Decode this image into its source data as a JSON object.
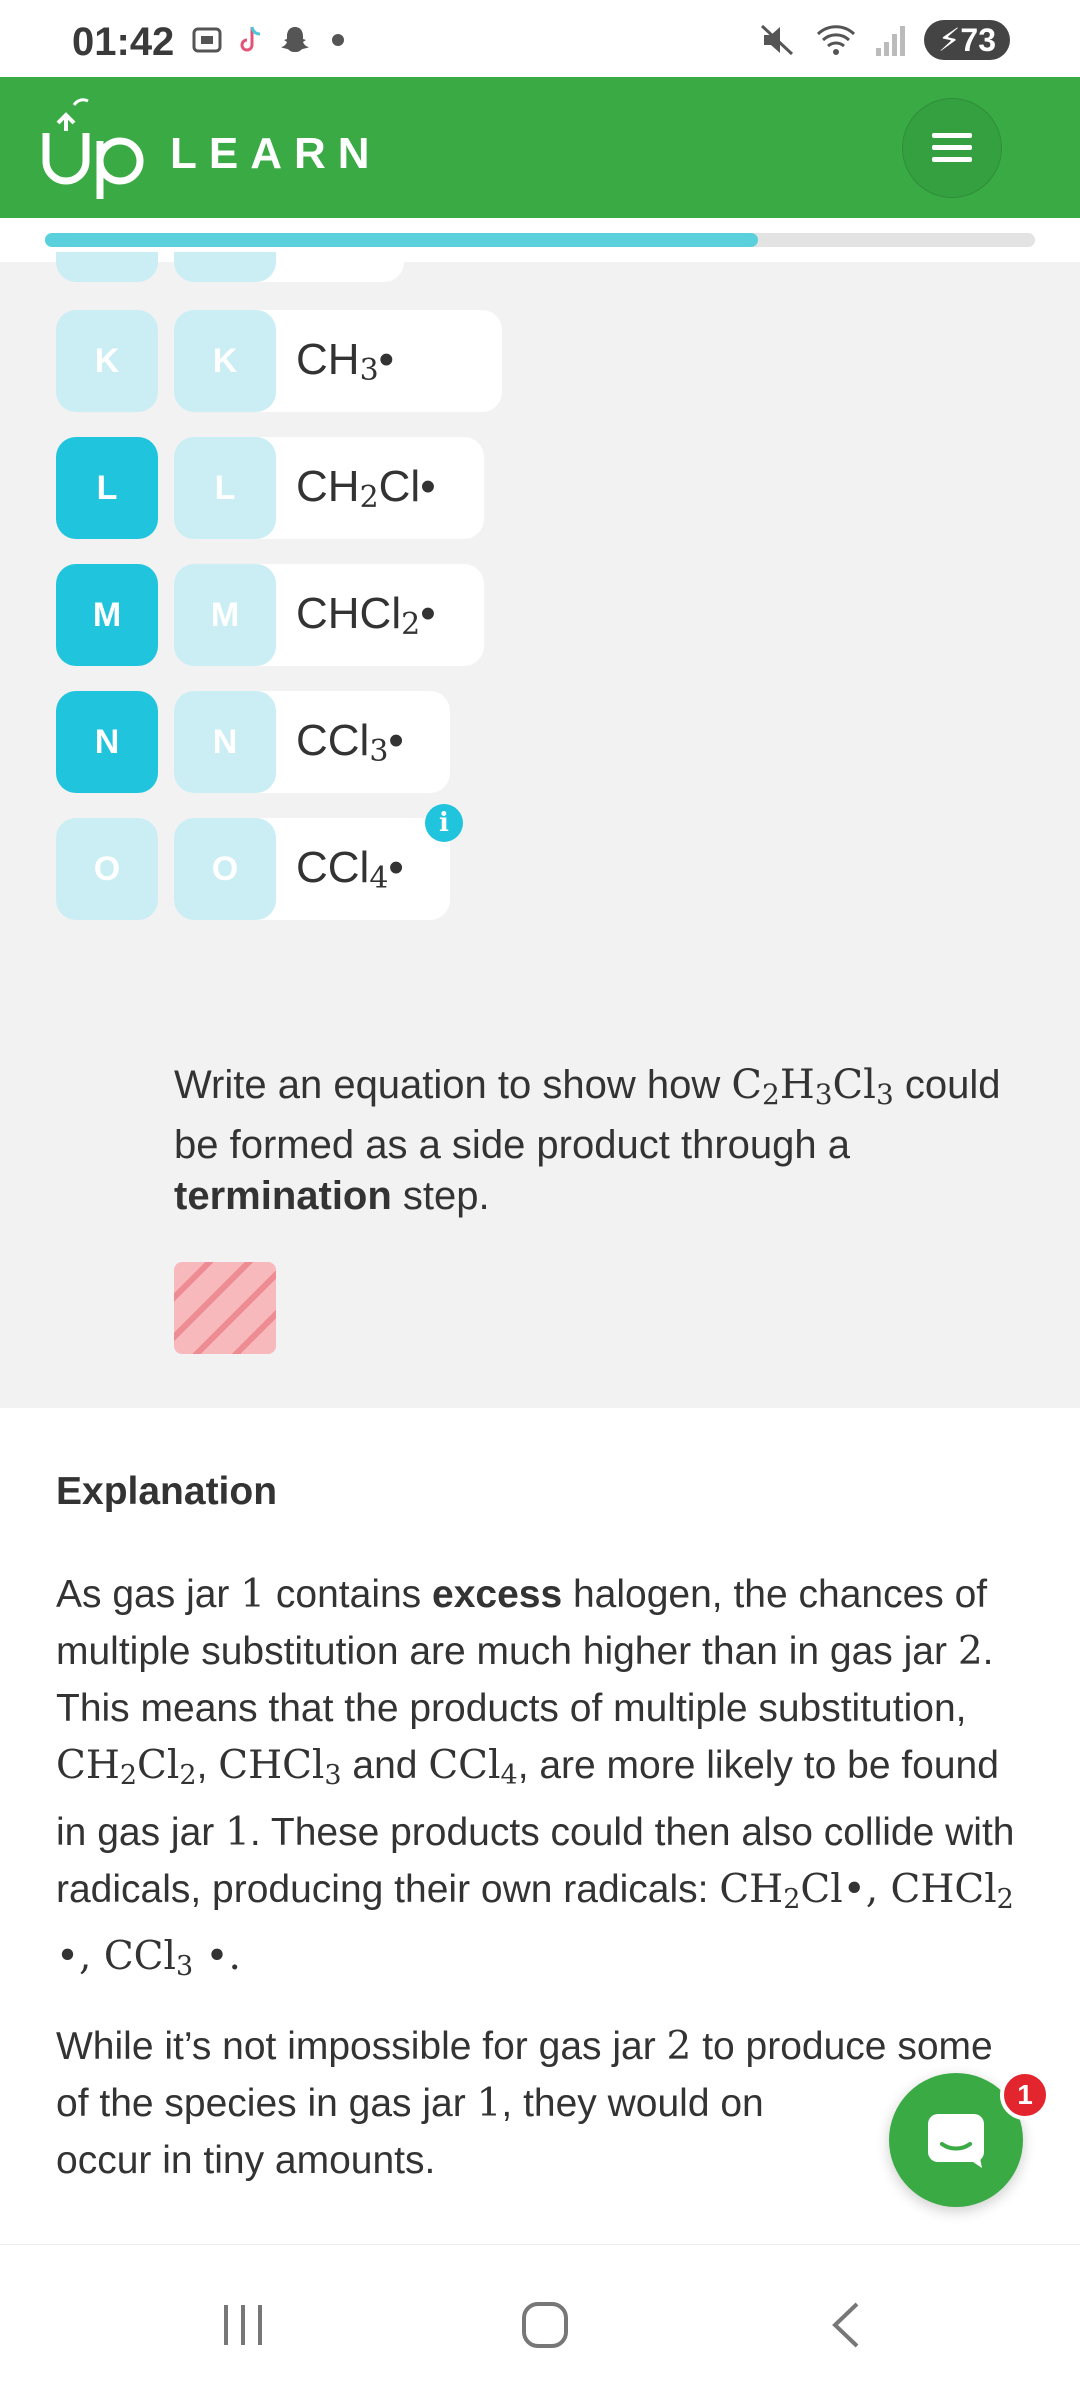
{
  "status_bar": {
    "time": "01:42",
    "battery": "73",
    "icons_left": [
      "screenshot-icon",
      "tiktok-icon",
      "snapchat-icon",
      "dot-icon"
    ],
    "icons_right": [
      "mute-icon",
      "wifi-icon",
      "signal-icon",
      "battery-icon"
    ]
  },
  "header": {
    "brand_text": "LEARN",
    "menu_icon": "hamburger-menu-icon"
  },
  "progress": {
    "fraction": 0.72
  },
  "options": [
    {
      "letter": "K",
      "selected": false,
      "formula_main": "CH",
      "formula_sub": "3",
      "formula_tail": "•"
    },
    {
      "letter": "L",
      "selected": true,
      "formula_main": "CH",
      "formula_sub": "2",
      "formula_tail": "Cl•"
    },
    {
      "letter": "M",
      "selected": true,
      "formula_main": "CHCl",
      "formula_sub": "2",
      "formula_tail": "•"
    },
    {
      "letter": "N",
      "selected": true,
      "formula_main": "CCl",
      "formula_sub": "3",
      "formula_tail": "•"
    },
    {
      "letter": "O",
      "selected": false,
      "formula_main": "CCl",
      "formula_sub": "4",
      "formula_tail": "•"
    }
  ],
  "info_badge": "i",
  "question": {
    "text_before": "Write an equation to show how ",
    "c": "C",
    "c_sub": "2",
    "h": "H",
    "h_sub": "3",
    "cl": "Cl",
    "cl_sub": "3",
    "text_middle": " could be formed as a side product through a ",
    "bold": "termination",
    "text_after": " step."
  },
  "explanation": {
    "title": "Explanation",
    "p1": {
      "a": "As gas jar ",
      "n1": "1",
      "b": " contains ",
      "bold": "excess",
      "c": " halogen, the chances of multiple substitution are much higher than in gas jar ",
      "n2": "2",
      "d": ". This means that the products of multiple substitution, ",
      "f1": "CH",
      "f1s": "2",
      "f1b": "Cl",
      "f1bs": "2",
      "e": ", ",
      "f2": "CHCl",
      "f2s": "3",
      "g": " and ",
      "f3": "CCl",
      "f3s": "4",
      "h": ", are more likely to be found in gas jar ",
      "n3": "1",
      "i": ". These products could then also collide with radicals, producing their own radicals: ",
      "r1": "CH",
      "r1s": "2",
      "r1t": "Cl•, ",
      "r2": "CHCl",
      "r2s": "2",
      "r2t": " •, ",
      "r3": "CCl",
      "r3s": "3",
      "r3t": " •."
    },
    "p2": {
      "a": "While it’s not impossible for gas jar ",
      "n": "2",
      "b": " to produce some of the species in gas jar ",
      "n2": "1",
      "c": ", they would on",
      "d": "occur in tiny amounts."
    }
  },
  "chat": {
    "badge": "1",
    "icon": "chat-icon"
  },
  "nav": [
    "recent-apps-icon",
    "home-icon",
    "back-icon"
  ]
}
